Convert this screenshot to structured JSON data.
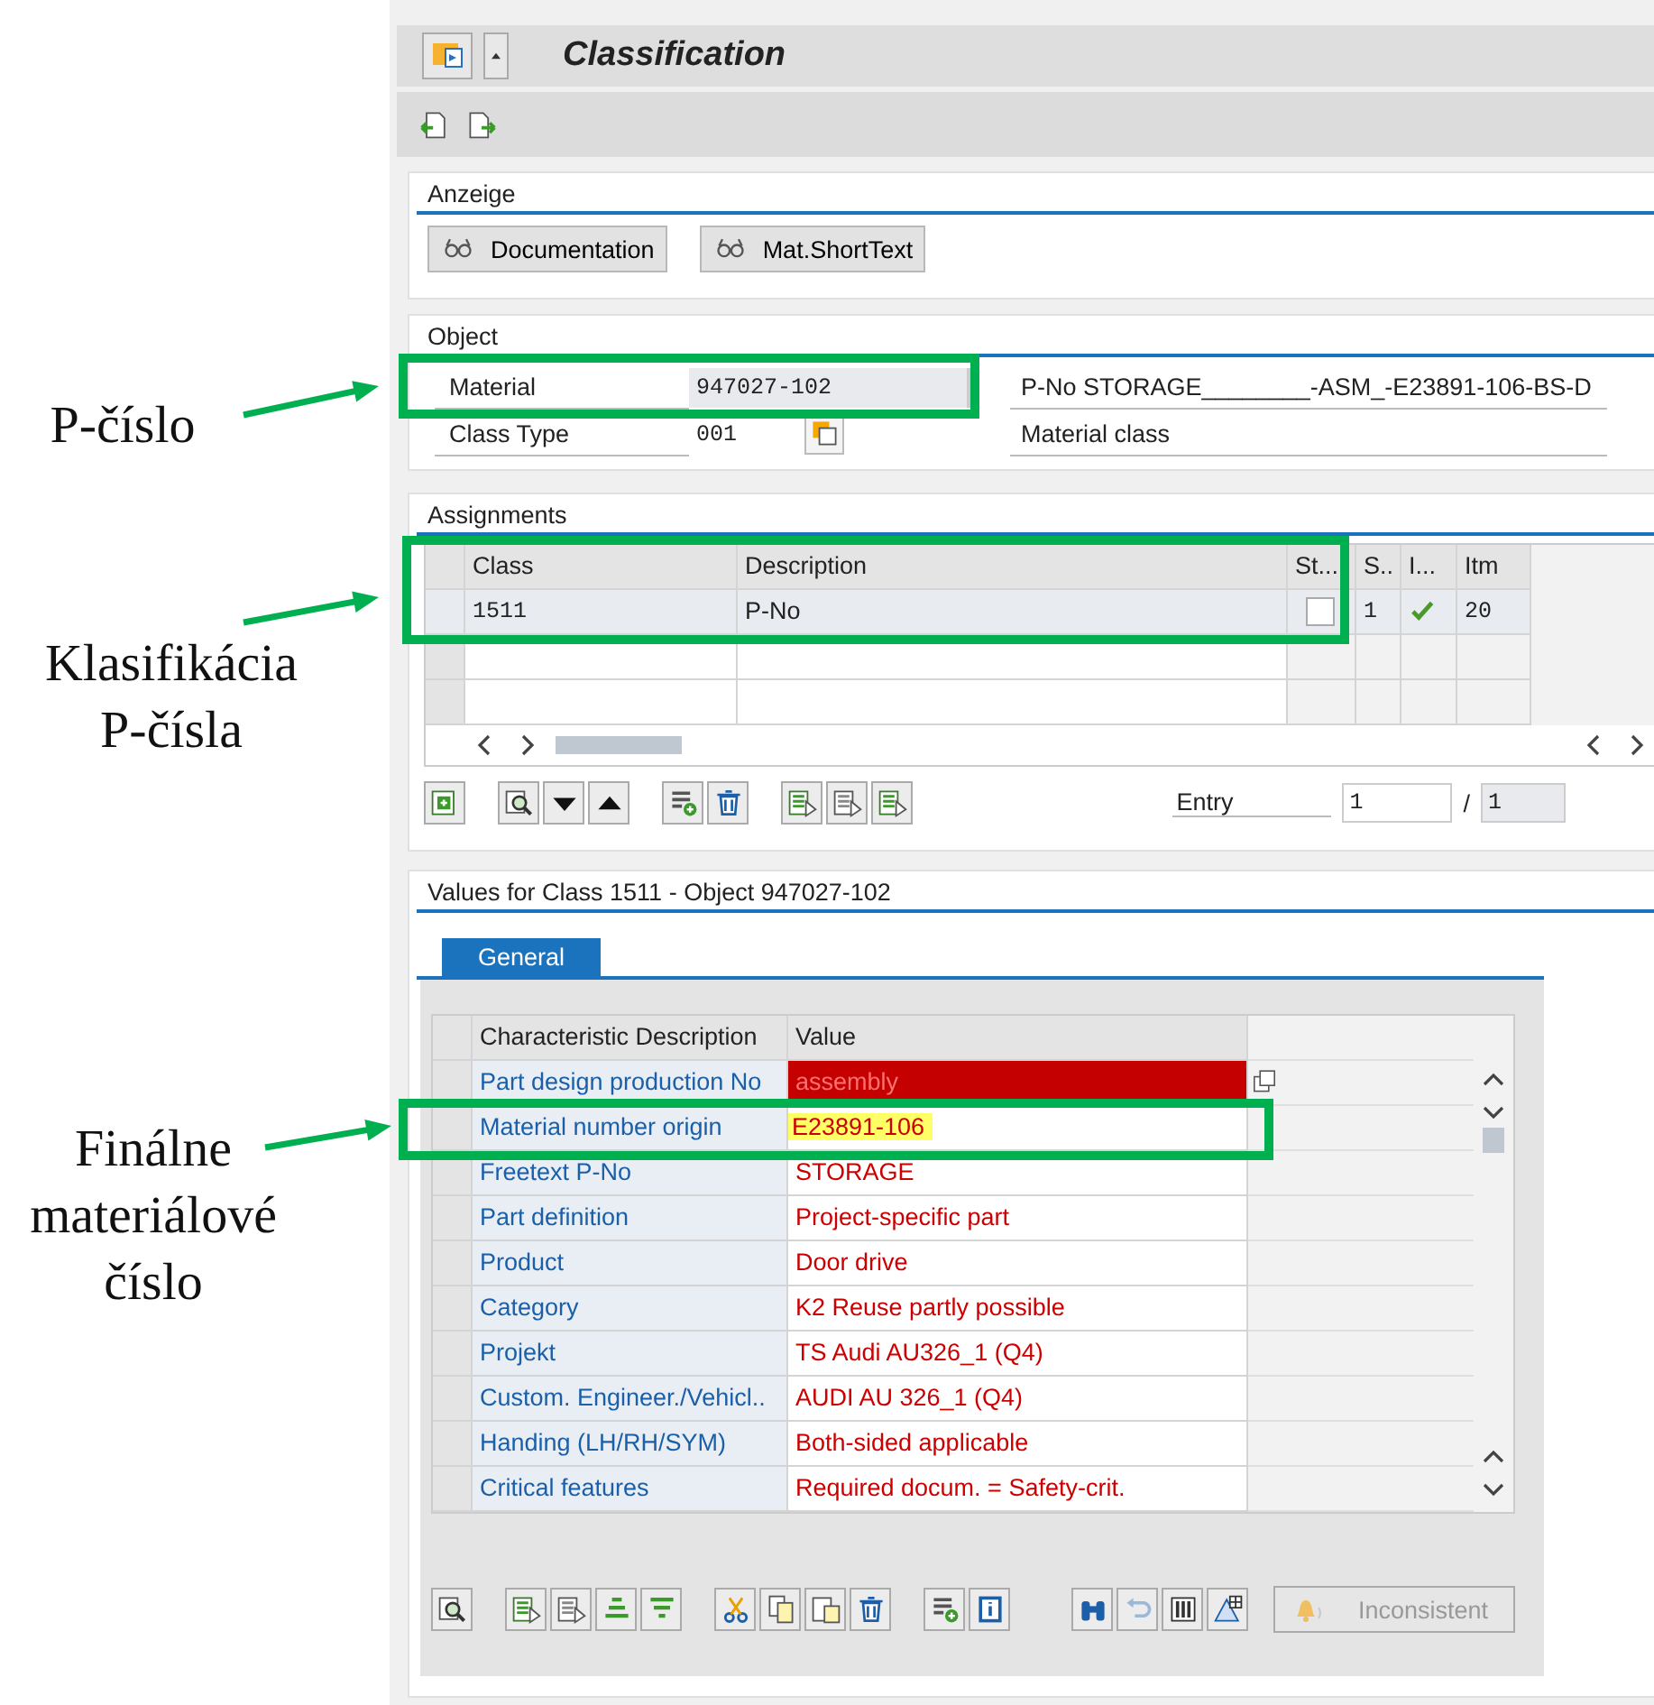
{
  "annotations": [
    {
      "label": "P-číslo"
    },
    {
      "label": "Klasifikácia\nP-čísla"
    },
    {
      "label": "Finálne\nmateriálové\nčíslo"
    }
  ],
  "window": {
    "title": "Classification"
  },
  "display_panel": {
    "title": "Anzeige",
    "buttons": [
      "Documentation",
      "Mat.ShortText"
    ]
  },
  "object_panel": {
    "title": "Object",
    "fields": [
      {
        "label": "Material",
        "value": "947027-102",
        "readonly": true,
        "description": "P-No STORAGE________-ASM_-E23891-106-BS-D"
      },
      {
        "label": "Class Type",
        "value": "001",
        "readonly": false,
        "description": "Material class"
      }
    ]
  },
  "assignments": {
    "title": "Assignments",
    "columns": [
      "Class",
      "Description",
      "St...",
      "S..",
      "I...",
      "Itm"
    ],
    "rows": [
      {
        "class": "1511",
        "description": "P-No",
        "selected": true,
        "checked": false,
        "s": "1",
        "consistent": true,
        "itm": "20"
      }
    ],
    "entry_label": "Entry",
    "entry_value": "1",
    "entry_separator": "/",
    "entry_total": "1"
  },
  "values": {
    "title": "Values for Class 1511 - Object 947027-102",
    "tabs": [
      {
        "label": "General",
        "selected": true
      }
    ],
    "columns": [
      "Characteristic Description",
      "Value"
    ],
    "rows": [
      {
        "description": "Part design production No",
        "value": "assembly",
        "error": true,
        "highlighted": false
      },
      {
        "description": "Material number origin",
        "value": "E23891-106",
        "error": false,
        "highlighted": true
      },
      {
        "description": "Freetext P-No",
        "value": "STORAGE",
        "error": false,
        "highlighted": false
      },
      {
        "description": "Part definition",
        "value": "Project-specific part",
        "error": false,
        "highlighted": false
      },
      {
        "description": "Product",
        "value": "Door drive",
        "error": false,
        "highlighted": false
      },
      {
        "description": "Category",
        "value": "K2 Reuse partly possible",
        "error": false,
        "highlighted": false
      },
      {
        "description": "Projekt",
        "value": "TS Audi AU326_1 (Q4)",
        "error": false,
        "highlighted": false
      },
      {
        "description": "Custom. Engineer./Vehicl..",
        "value": "AUDI AU 326_1 (Q4)",
        "error": false,
        "highlighted": false
      },
      {
        "description": "Handing (LH/RH/SYM)",
        "value": "Both-sided applicable",
        "error": false,
        "highlighted": false
      },
      {
        "description": "Critical features",
        "value": "Required docum. = Safety-crit.",
        "error": false,
        "highlighted": false
      }
    ],
    "status_button": {
      "label": "Inconsistent",
      "disabled": true
    }
  }
}
